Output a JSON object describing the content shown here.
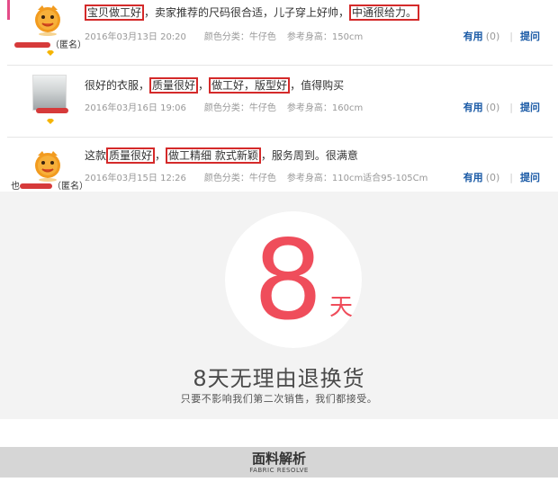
{
  "colors": {
    "accent_red": "#ef4d5b",
    "highlight_box": "#d42a2a",
    "link_blue": "#1a5aa6"
  },
  "reviews": [
    {
      "avatar": "cartoon-avatar-icon",
      "username_suffix": "（匿名）",
      "text_parts": [
        "宝贝做工好",
        "，卖家推荐的尺码很合适，儿子穿上好帅，",
        "中通很给力。"
      ],
      "date": "2016年03月13日 20:20",
      "color_class": "颜色分类：牛仔色",
      "height_ref": "参考身高：150cm",
      "useful_label": "有用",
      "useful_count": "(0)",
      "ask_label": "提问"
    },
    {
      "avatar": "photo-avatar",
      "text_parts": [
        "很好的衣服，",
        "质量很好",
        "，",
        "做工好，版型好",
        "，值得购买"
      ],
      "date": "2016年03月16日 19:06",
      "color_class": "颜色分类：牛仔色",
      "height_ref": "参考身高：160cm",
      "useful_label": "有用",
      "useful_count": "(0)",
      "ask_label": "提问"
    },
    {
      "avatar": "cartoon-avatar-icon",
      "username_prefix": "也",
      "username_suffix": "（匿名）",
      "text_parts": [
        "这款",
        "质量很好",
        "，",
        "做工精细 款式新颖",
        "，服务周到。很满意"
      ],
      "date": "2016年03月15日 12:26",
      "color_class": "颜色分类：牛仔色",
      "height_ref": "参考身高：110cm适合95-105Cm",
      "useful_label": "有用",
      "useful_count": "(0)",
      "ask_label": "提问"
    }
  ],
  "return_policy": {
    "number": "8",
    "unit": "天",
    "title": "8天无理由退换货",
    "subtitle": "只要不影响我们第二次销售，我们都接受。"
  },
  "fabric": {
    "title": "面料解析",
    "subtitle": "FABRIC RESOLVE"
  }
}
